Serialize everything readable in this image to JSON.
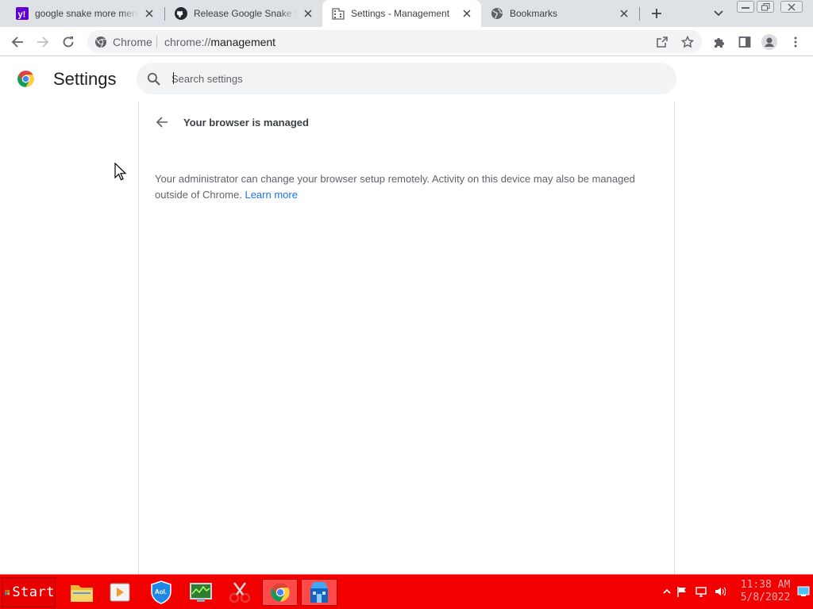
{
  "tabs": [
    {
      "title": "google snake more menu st",
      "favicon": "yahoo-icon"
    },
    {
      "title": "Release Google Snake Menu",
      "favicon": "github-icon"
    },
    {
      "title": "Settings - Management",
      "favicon": "management-building-icon",
      "active": true
    },
    {
      "title": "Bookmarks",
      "favicon": "globe-icon"
    }
  ],
  "omnibox": {
    "site_chip": "Chrome",
    "url_scheme": "chrome://",
    "url_path": "management"
  },
  "settings": {
    "title": "Settings",
    "search_placeholder": "Search settings"
  },
  "management": {
    "heading": "Your browser is managed",
    "description": "Your administrator can change your browser setup remotely. Activity on this device may also be managed outside of Chrome.",
    "learn_more": "Learn more"
  },
  "taskbar": {
    "start_label": "Start",
    "apps": [
      "file-explorer-icon",
      "media-player-icon",
      "aol-shield-icon",
      "task-manager-icon",
      "snipping-tool-icon",
      "chrome-icon",
      "store-icon"
    ],
    "active_app": "chrome-icon",
    "clock_time": "11:38 AM",
    "clock_date": "5/8/2022"
  },
  "colors": {
    "taskbar": "#f20000",
    "link": "#1a73e8",
    "tabstrip": "#dee1e6"
  }
}
